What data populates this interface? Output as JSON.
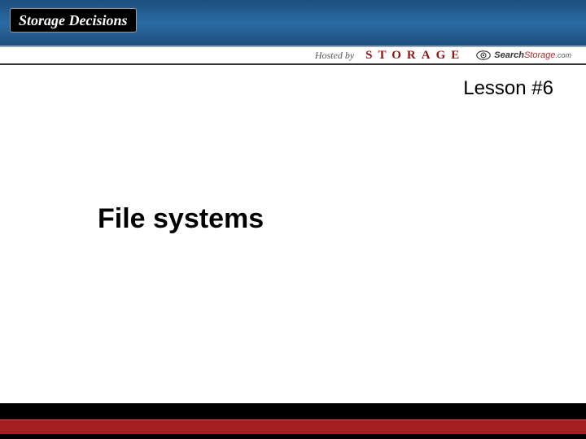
{
  "header": {
    "logo_text": "Storage Decisions"
  },
  "hosted": {
    "label": "Hosted by",
    "brand1": "STORAGE",
    "brand2_part1": "Search",
    "brand2_part2": "Storage",
    "brand2_suffix": ".com"
  },
  "lesson": {
    "label": "Lesson #6"
  },
  "title": "File systems"
}
